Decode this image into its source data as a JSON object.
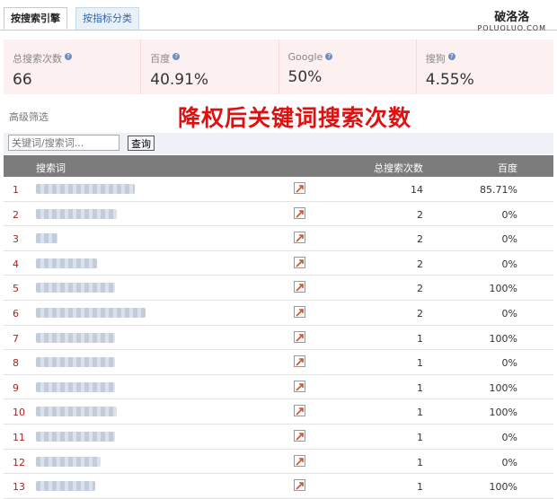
{
  "tabs": {
    "by_engine": "按搜索引擎",
    "by_metric": "按指标分类"
  },
  "watermark": {
    "cn": "破洛洛",
    "en": "POLUOLUO.COM"
  },
  "stats": [
    {
      "label": "总搜索次数",
      "value": "66"
    },
    {
      "label": "百度",
      "value": "40.91%"
    },
    {
      "label": "Google",
      "value": "50%"
    },
    {
      "label": "搜狗",
      "value": "4.55%"
    }
  ],
  "filter": {
    "advanced_label": "高级筛选",
    "banner": "降权后关键词搜索次数",
    "search_placeholder": "关键词/搜索词...",
    "search_button": "查询"
  },
  "table": {
    "headers": {
      "keyword": "搜索词",
      "total": "总搜索次数",
      "baidu": "百度"
    },
    "rows": [
      {
        "n": "1",
        "total": "14",
        "baidu": "85.71%",
        "kw_width": 110
      },
      {
        "n": "2",
        "total": "2",
        "baidu": "0%",
        "kw_width": 90
      },
      {
        "n": "3",
        "total": "2",
        "baidu": "0%",
        "kw_width": 24
      },
      {
        "n": "4",
        "total": "2",
        "baidu": "0%",
        "kw_width": 68
      },
      {
        "n": "5",
        "total": "2",
        "baidu": "100%",
        "kw_width": 88
      },
      {
        "n": "6",
        "total": "2",
        "baidu": "0%",
        "kw_width": 122
      },
      {
        "n": "7",
        "total": "1",
        "baidu": "100%",
        "kw_width": 88
      },
      {
        "n": "8",
        "total": "1",
        "baidu": "0%",
        "kw_width": 88
      },
      {
        "n": "9",
        "total": "1",
        "baidu": "100%",
        "kw_width": 88
      },
      {
        "n": "10",
        "total": "1",
        "baidu": "100%",
        "kw_width": 90
      },
      {
        "n": "11",
        "total": "1",
        "baidu": "0%",
        "kw_width": 88
      },
      {
        "n": "12",
        "total": "1",
        "baidu": "0%",
        "kw_width": 72
      },
      {
        "n": "13",
        "total": "1",
        "baidu": "100%",
        "kw_width": 66
      }
    ]
  }
}
